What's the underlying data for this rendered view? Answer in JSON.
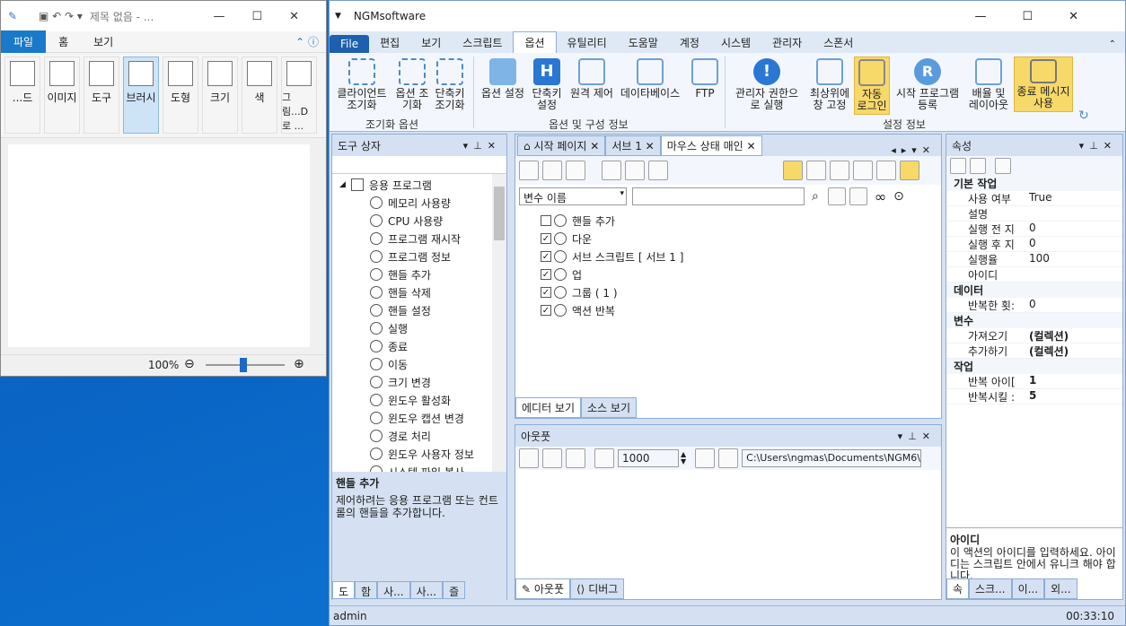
{
  "paint": {
    "title": "제목 없음 - ...",
    "tabs": [
      "파일",
      "홈",
      "보기"
    ],
    "tools": [
      "...드",
      "이미지",
      "도구",
      "브러시",
      "도형",
      "크기",
      "색",
      "그림...D로 ..."
    ],
    "zoom": "100%"
  },
  "main": {
    "title": "NGMsoftware",
    "menu": [
      "File",
      "편집",
      "보기",
      "스크립트",
      "옵션",
      "유틸리티",
      "도움말",
      "계정",
      "시스템",
      "관리자",
      "스폰서"
    ],
    "ribbon": {
      "buttons": [
        "클라이언트 조기화",
        "옵션 조기화",
        "단축키 조기화",
        "옵션 설정",
        "단축키 설정",
        "원격 제어",
        "데이타베이스",
        "FTP",
        "관리자 권한으로 실행",
        "최상위에 창 고정",
        "자동 로그인",
        "시작 프로그램 등록",
        "배율 및 레이아웃",
        "종료 메시지 사용"
      ],
      "groups": [
        "조기화 옵션",
        "옵션 및 구성 정보",
        "설정 정보"
      ]
    },
    "toolbox": {
      "title": "도구 상자",
      "root": "응용 프로그램",
      "items": [
        "메모리 사용량",
        "CPU 사용량",
        "프로그램 재시작",
        "프로그램 정보",
        "핸들 추가",
        "핸들 삭제",
        "핸들 설정",
        "실행",
        "종료",
        "이동",
        "크기 변경",
        "윈도우 활성화",
        "윈도우 캡션 변경",
        "경로 처리",
        "윈도우 사용자 정보",
        "시스템 파일 복사"
      ],
      "desc_title": "핸들 추가",
      "desc_text": "제어하려는 응용 프로그램 또는 컨트롤의 핸들을 추가합니다.",
      "bottom_tabs": [
        "도",
        "함",
        "사...",
        "사...",
        "즐"
      ]
    },
    "editor": {
      "tabs": [
        "시작 페이지",
        "서브 1",
        "마우스 상태 매인"
      ],
      "var_placeholder": "변수 이름",
      "nodes": [
        {
          "label": "핸들 추가",
          "checked": false
        },
        {
          "label": "다운",
          "checked": true
        },
        {
          "label": "서브 스크립트 [ 서브 1 ]",
          "checked": true
        },
        {
          "label": "업",
          "checked": true
        },
        {
          "label": "그룹 ( 1 )",
          "checked": true
        },
        {
          "label": "액션 반복",
          "checked": true
        }
      ],
      "view_tabs": [
        "에디터 보기",
        "소스 보기"
      ]
    },
    "output": {
      "title": "아웃풋",
      "count": "1000",
      "path": "C:\\Users\\ngmas\\Documents\\NGM6\\",
      "bottom_tabs": [
        "아웃풋",
        "디버그"
      ]
    },
    "props": {
      "title": "속성",
      "cat1": "기본 작업",
      "cat2": "데이터",
      "cat3": "변수",
      "cat4": "작업",
      "rows1": [
        [
          "사용 여부",
          "True"
        ],
        [
          "설명",
          ""
        ],
        [
          "실행 전 지",
          "0"
        ],
        [
          "실행 후 지",
          "0"
        ],
        [
          "실행율",
          "100"
        ],
        [
          "아이디",
          ""
        ]
      ],
      "rows2": [
        [
          "반복한 횟:",
          "0"
        ]
      ],
      "rows3": [
        [
          "가져오기",
          "(컬렉션)"
        ],
        [
          "추가하기",
          "(컬렉션)"
        ]
      ],
      "rows4": [
        [
          "반복 아이[",
          "1"
        ],
        [
          "반복시킬 :",
          "5"
        ]
      ],
      "desc_title": "아이디",
      "desc_text": "이 액션의 아이디를 입력하세요. 아이디는 스크립트 안에서 유니크 해야 합니다.",
      "bottom_tabs": [
        "속",
        "스크...",
        "이...",
        "외..."
      ]
    },
    "status": {
      "user": "admin",
      "time": "00:33:10"
    }
  }
}
